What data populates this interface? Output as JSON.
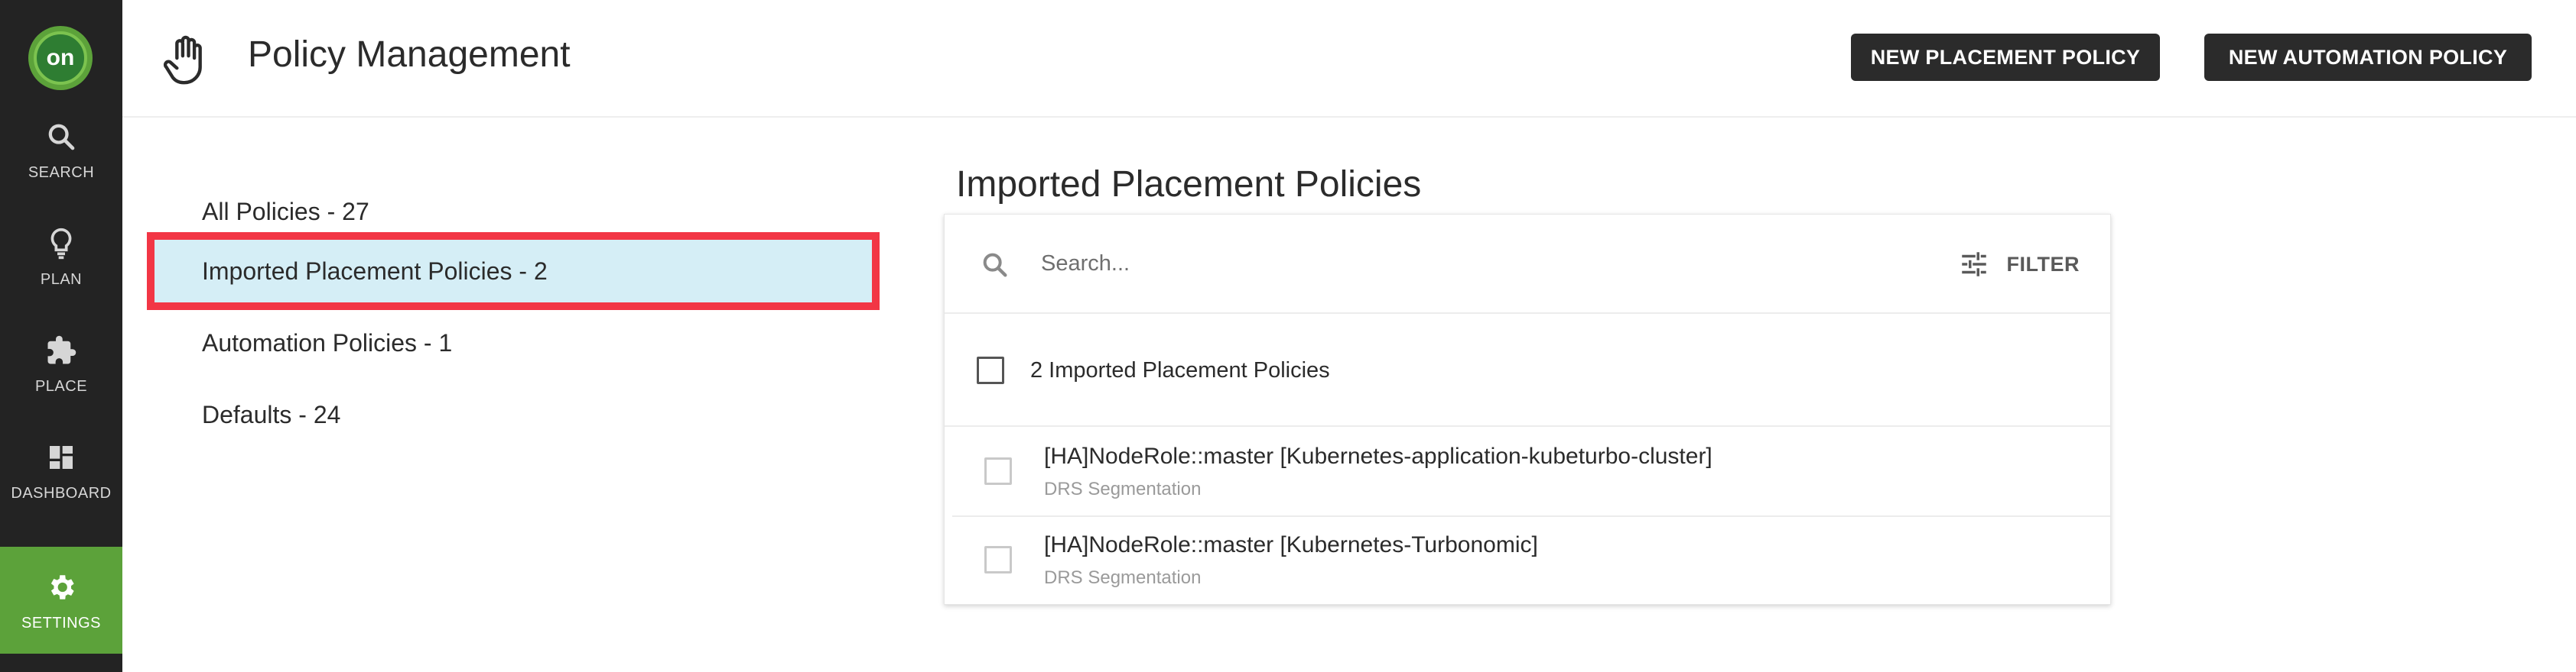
{
  "logo": {
    "text": "on"
  },
  "nav": [
    {
      "label": "SEARCH",
      "icon": "search-icon"
    },
    {
      "label": "PLAN",
      "icon": "lightbulb-icon"
    },
    {
      "label": "PLACE",
      "icon": "puzzle-icon"
    },
    {
      "label": "DASHBOARD",
      "icon": "dashboard-icon"
    },
    {
      "label": "SETTINGS",
      "icon": "gear-icon",
      "active": true
    }
  ],
  "header": {
    "title": "Policy Management",
    "icon": "hand-icon",
    "new_placement_label": "NEW PLACEMENT POLICY",
    "new_automation_label": "NEW AUTOMATION POLICY"
  },
  "policy_nav": [
    {
      "label": "All Policies - 27"
    },
    {
      "label": "Imported Placement Policies - 2",
      "selected": true
    },
    {
      "label": "Automation Policies - 1"
    },
    {
      "label": "Defaults - 24"
    }
  ],
  "main": {
    "title": "Imported Placement Policies",
    "search_placeholder": "Search...",
    "filter_label": "FILTER",
    "select_all_label": "2 Imported Placement Policies",
    "rows": [
      {
        "name": "[HA]NodeRole::master [Kubernetes-application-kubeturbo-cluster]",
        "type": "DRS Segmentation"
      },
      {
        "name": "[HA]NodeRole::master [Kubernetes-Turbonomic]",
        "type": "DRS Segmentation"
      }
    ]
  },
  "colors": {
    "rail_bg": "#232323",
    "accent_green": "#5ca23a",
    "selected_bg": "#d5eef6",
    "highlight_border": "#f23645",
    "button_bg": "#2b2b2b"
  }
}
